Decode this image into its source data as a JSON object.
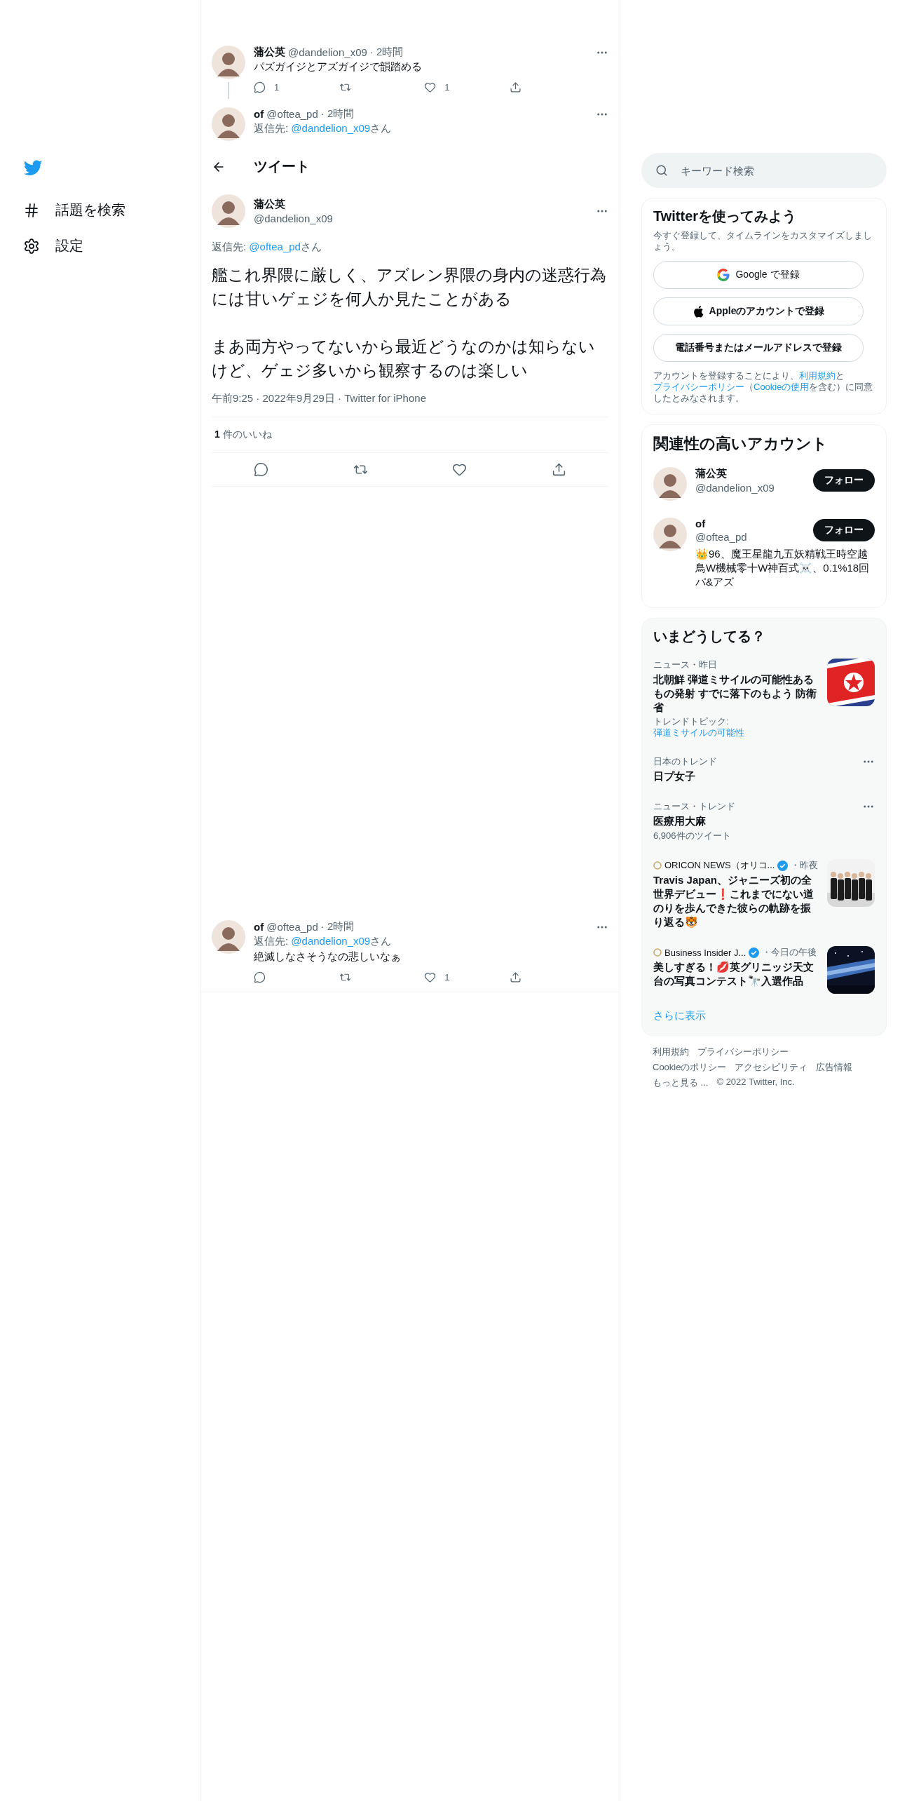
{
  "sidebar": {
    "items": [
      {
        "kind": "explore",
        "label": "話題を検索"
      },
      {
        "kind": "settings",
        "label": "設定"
      }
    ]
  },
  "thread": [
    {
      "name": "蒲公英",
      "handle": "@dandelion_x09",
      "time": "· 2時間",
      "text": "パズガイジとアズガイジで韻踏める",
      "actions": [
        {
          "kind": "reply",
          "count": "1"
        },
        {
          "kind": "retweet"
        },
        {
          "kind": "like",
          "count": "1"
        },
        {
          "kind": "share"
        }
      ]
    },
    {
      "name": "of",
      "handle": "@oftea_pd",
      "time": "· 2時間",
      "reply_prefix": "返信先:",
      "reply_handle": "@dandelion_x09",
      "reply_suffix": "さん"
    }
  ],
  "header": {
    "title": "ツイート"
  },
  "main_tweet": {
    "name": "蒲公英",
    "handle": "@dandelion_x09",
    "reply_prefix": "返信先:",
    "reply_handle": "@oftea_pd",
    "reply_suffix": "さん",
    "paragraphs": [
      "艦これ界隈に厳しく、アズレン界隈の身内の迷惑行為には甘いゲェジを何人か見たことがある",
      "まあ両方やってないから最近どうなのかは知らないけど、ゲェジ多いから観察するのは楽しい"
    ],
    "date": "午前9:25 · 2022年9月29日 · Twitter for iPhone",
    "likes_count": "1",
    "likes_label": "件のいいね",
    "actions": [
      {
        "kind": "reply"
      },
      {
        "kind": "retweet"
      },
      {
        "kind": "like"
      },
      {
        "kind": "share"
      }
    ]
  },
  "replies": [
    {
      "name": "of",
      "handle": "@oftea_pd",
      "time": "· 2時間",
      "reply_prefix": "返信先:",
      "reply_handle": "@dandelion_x09",
      "reply_suffix": "さん",
      "text": "絶滅しなさそうなの悲しいなぁ",
      "actions": [
        {
          "kind": "reply"
        },
        {
          "kind": "retweet"
        },
        {
          "kind": "like",
          "count": "1"
        },
        {
          "kind": "share"
        }
      ]
    }
  ],
  "search": {
    "placeholder": "キーワード検索"
  },
  "signup": {
    "title": "Twitterを使ってみよう",
    "subtitle": "今すぐ登録して、タイムラインをカスタマイズしましょう。",
    "buttons": [
      {
        "kind": "google",
        "label": "Google で登録"
      },
      {
        "kind": "apple",
        "label": "Appleのアカウントで登録"
      },
      {
        "kind": "phone",
        "label": "電話番号またはメールアドレスで登録"
      }
    ],
    "legal": [
      {
        "text": "アカウントを登録することにより、",
        "link": false
      },
      {
        "text": "利用規約",
        "link": true
      },
      {
        "text": "と",
        "link": false
      },
      {
        "text": "プライバシーポリシー",
        "link": true
      },
      {
        "text": "（",
        "link": false
      },
      {
        "text": "Cookieの使用",
        "link": true
      },
      {
        "text": "を含む）に同意したとみなされます。",
        "link": false
      }
    ]
  },
  "relevant": {
    "title": "関連性の高いアカウント",
    "accounts": [
      {
        "name": "蒲公英",
        "handle": "@dandelion_x09",
        "button": "フォロー"
      },
      {
        "name": "of",
        "handle": "@oftea_pd",
        "button": "フォロー",
        "bio": "👑96、魔王星龍九五妖精戦王時空越鳥W機械零十W神百式☠️、0.1%18回パ&アズ"
      }
    ]
  },
  "trends": {
    "title": "いまどうしてる？",
    "items": [
      {
        "kind": "news",
        "meta": "ニュース・昨日",
        "title": "北朝鮮 弾道ミサイルの可能性あるもの発射 すでに落下のもよう 防衛省",
        "topic_prefix": "トレンドトピック:",
        "topic_link": "弾道ミサイルの可能性"
      },
      {
        "kind": "trend",
        "meta": "日本のトレンド",
        "title": "日プ女子"
      },
      {
        "kind": "trend",
        "meta": "ニュース・トレンド",
        "title": "医療用大麻",
        "count": "6,906件のツイート"
      },
      {
        "kind": "story",
        "source": "ORICON NEWS（オリコ...",
        "verified": true,
        "time": "・昨夜",
        "title": "Travis Japan、ジャニーズ初の全世界デビュー❗これまでにない道のりを歩んできた彼らの軌跡を振り返る🐯"
      },
      {
        "kind": "story",
        "source": "Business Insider J...",
        "verified": true,
        "time": "・今日の午後",
        "title": "美しすぎる！💋英グリニッジ天文台の写真コンテスト🔭入選作品"
      }
    ],
    "more": "さらに表示"
  },
  "footer": [
    [
      "利用規約",
      "プライバシーポリシー"
    ],
    [
      "Cookieのポリシー",
      "アクセシビリティ",
      "広告情報"
    ],
    [
      "もっと見る ...",
      "© 2022 Twitter, Inc."
    ]
  ]
}
